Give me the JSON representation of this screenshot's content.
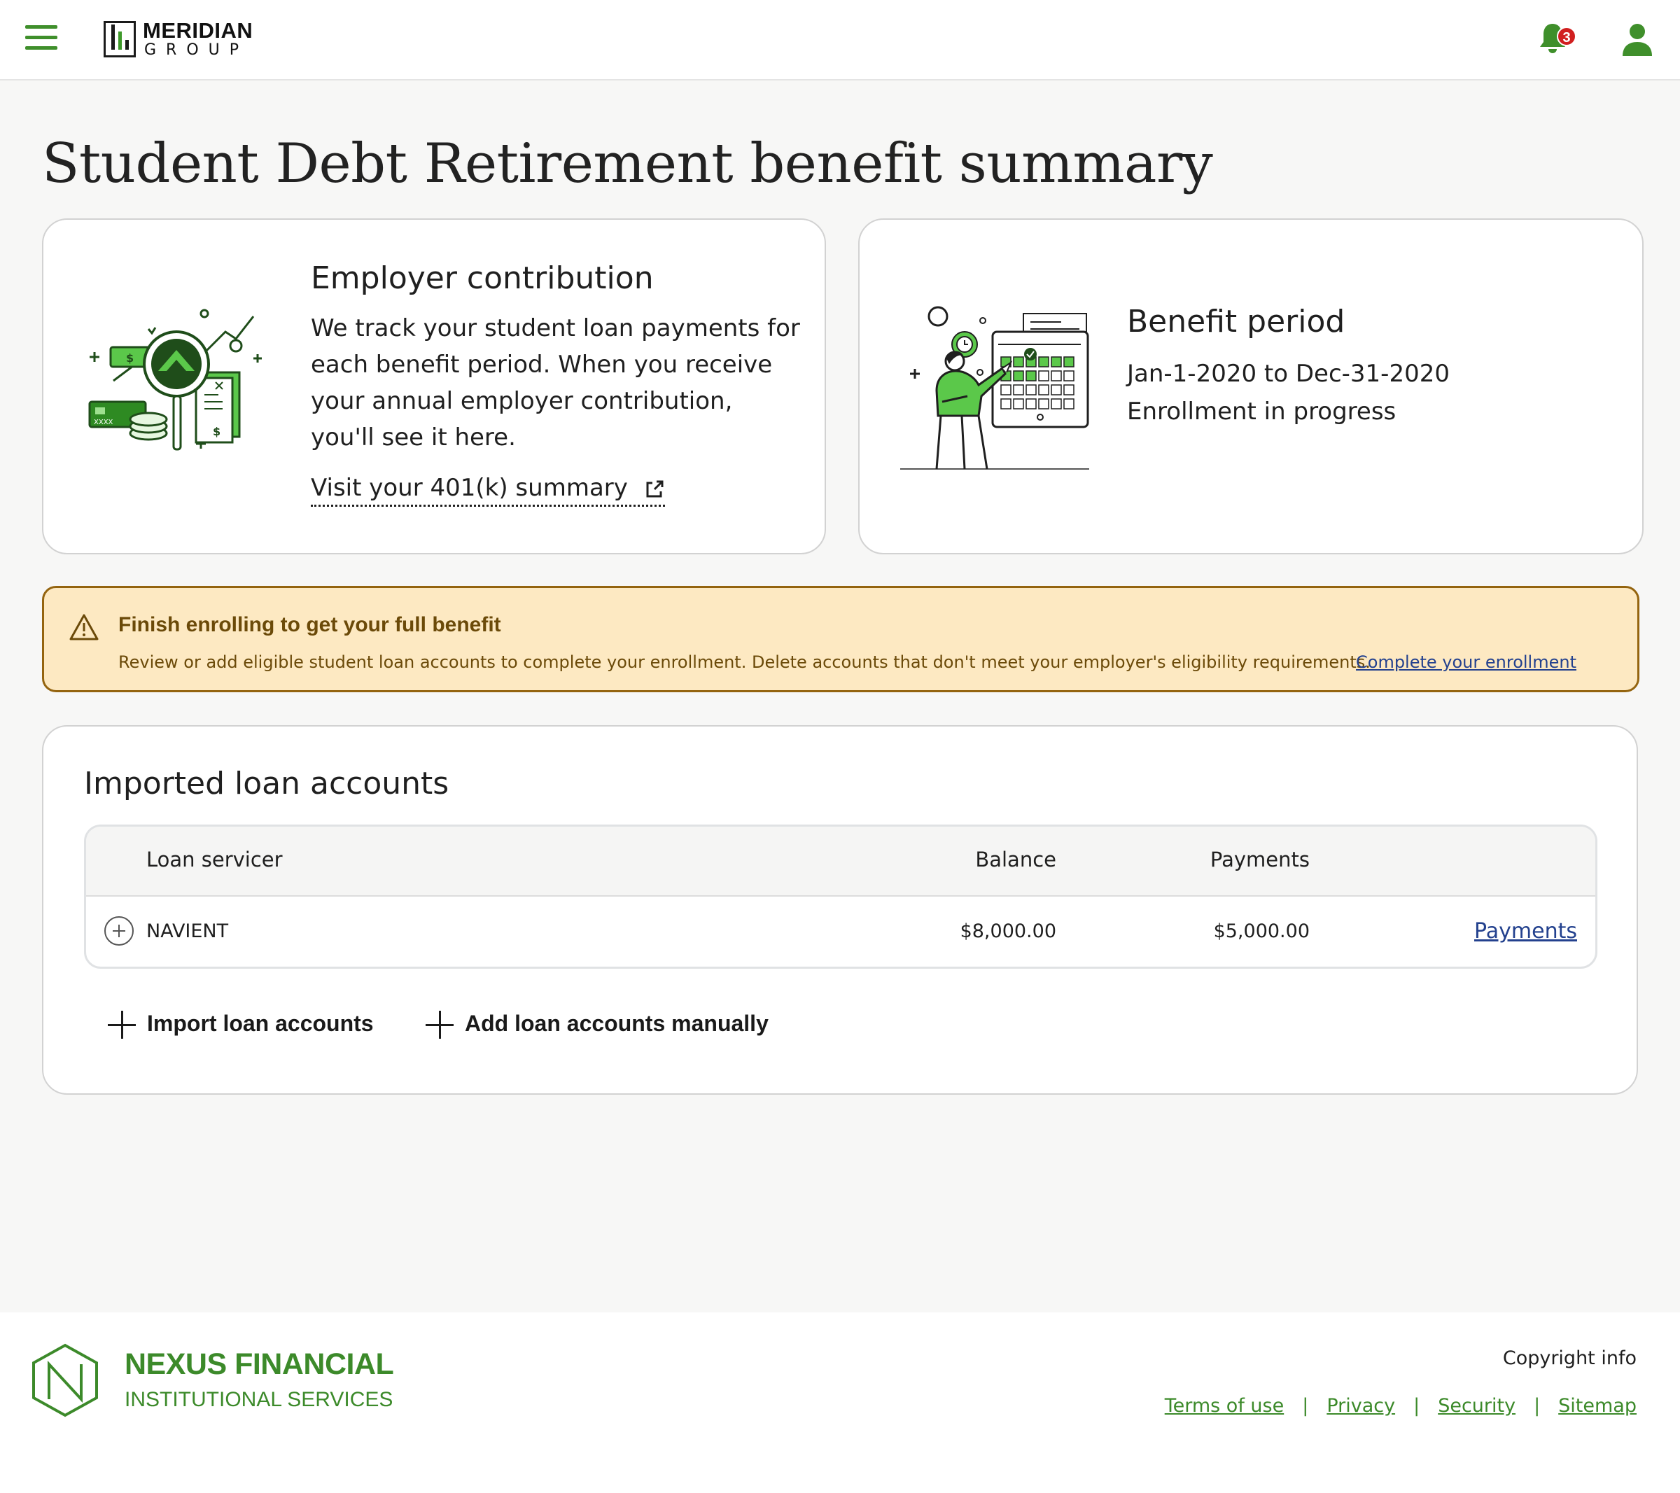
{
  "header": {
    "brand_name": "MERIDIAN",
    "brand_sub": "GROUP",
    "notification_count": "3",
    "icons": {
      "menu": "hamburger-menu-icon",
      "bell": "bell-icon",
      "user": "user-icon"
    },
    "accent_color": "#3f8f2b"
  },
  "page": {
    "title": "Student Debt Retirement benefit summary"
  },
  "employer_card": {
    "heading": "Employer contribution",
    "body": "We track your student loan payments for each benefit period. When you receive your annual employer contribution, you'll see it here.",
    "link_label": "Visit your 401(k) summary",
    "link_icon": "external-link-icon"
  },
  "period_card": {
    "heading": "Benefit period",
    "dates": "Jan-1-2020 to Dec-31-2020",
    "status": "Enrollment in progress"
  },
  "alert": {
    "title": "Finish enrolling to get your full benefit",
    "body": "Review or add eligible student loan accounts to complete your enrollment. Delete accounts that don't meet your employer's eligibility requirements.",
    "link_label": "Complete your enrollment",
    "icon": "warning-icon",
    "bg_color": "#fde9c2",
    "border_color": "#94640f"
  },
  "loans": {
    "title": "Imported loan accounts",
    "columns": {
      "servicer": "Loan servicer",
      "balance": "Balance",
      "payments": "Payments"
    },
    "rows": [
      {
        "servicer": "NAVIENT",
        "balance": "$8,000.00",
        "payments": "$5,000.00",
        "link_label": "Payments"
      }
    ],
    "actions": {
      "import": "Import loan accounts",
      "manual": "Add loan accounts manually"
    }
  },
  "footer": {
    "brand_name": "NEXUS FINANCIAL",
    "brand_sub": "INSTITUTIONAL SERVICES",
    "copyright": "Copyright info",
    "links": [
      "Terms of use",
      "Privacy",
      "Security",
      "Sitemap"
    ],
    "brand_color": "#3c8a2a"
  }
}
